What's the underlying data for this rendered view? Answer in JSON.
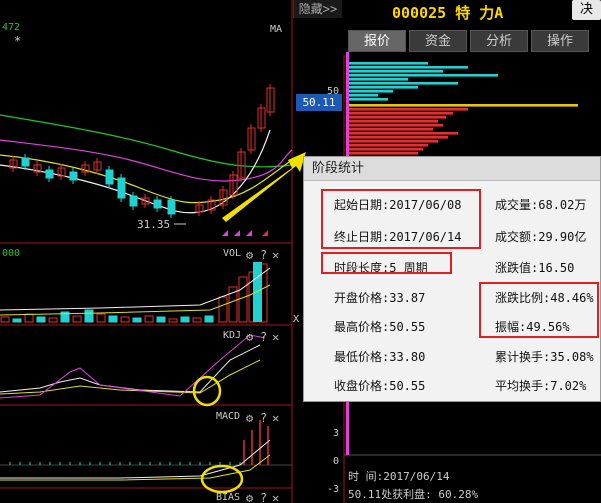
{
  "header": {
    "hide_label": "隐藏>>",
    "stock_title": "000025 特  力A",
    "decide_label": "决",
    "tabs": [
      "报价",
      "资金",
      "分析",
      "操作"
    ],
    "active_tab": 0
  },
  "chart": {
    "ma_label": "MA",
    "top_left_code": "472",
    "top_left_star": "*",
    "current_price_tag": "50.11",
    "axis_50": "50",
    "low_marker": "31.35",
    "vol_prefix": "000",
    "vol_label": "VOL",
    "kdj_label": "KDJ",
    "macd_label": "MACD",
    "bias_label": "BIAS",
    "x_label": "X",
    "macd_axis": [
      "3",
      "0",
      "-3"
    ],
    "icons": [
      "gear-icon",
      "question-icon",
      "close-icon"
    ],
    "colors": {
      "up": "#e03030",
      "down": "#22d0d0",
      "ma_green": "#22c822",
      "ma_magenta": "#e040e0",
      "ma_yellow": "#e0e020",
      "ma_white": "#f0f0f0",
      "highlight": "#f0e000"
    }
  },
  "popup": {
    "title": "阶段统计",
    "start_date": "起始日期:2017/06/08",
    "end_date": "终止日期:2017/06/14",
    "period": "时段长度:5  周期",
    "open": "开盘价格:33.87",
    "high": "最高价格:50.55",
    "low": "最低价格:33.80",
    "close": "收盘价格:50.55",
    "volume": "成交量:68.02万",
    "amount": "成交额:29.90亿",
    "change": "涨跌值:16.50",
    "change_pct": "涨跌比例:48.46%",
    "amplitude": "振幅:49.56%",
    "cum_turnover": "累计换手:35.08%",
    "avg_turnover": "平均换手:7.02%"
  },
  "footer": {
    "time_line": "时        间:2017/06/14",
    "profit_line": "50.11处获利盘: 60.28%"
  }
}
